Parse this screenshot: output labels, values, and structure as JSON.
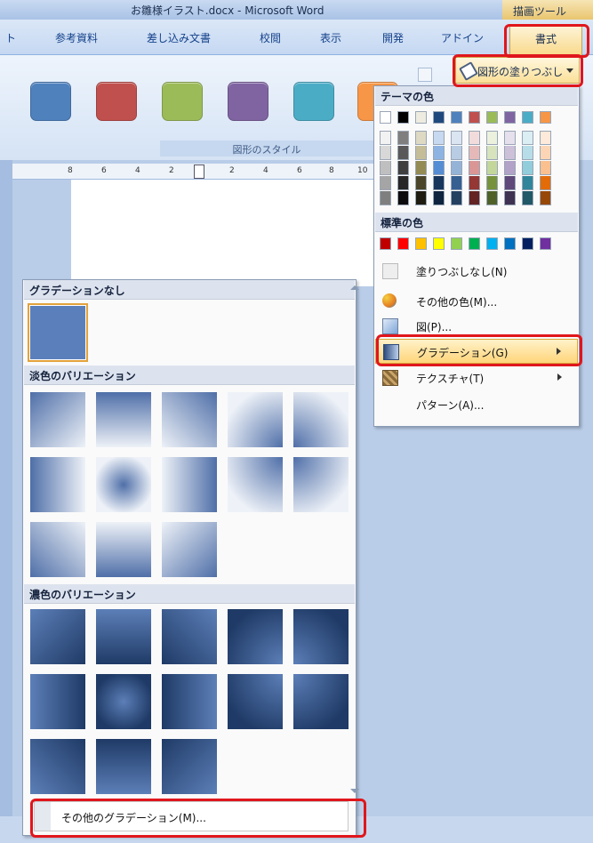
{
  "window": {
    "title": "お雛様イラスト.docx - Microsoft Word",
    "context_tool": "描画ツール"
  },
  "tabs": [
    "ト",
    "参考資料",
    "差し込み文書",
    "校閲",
    "表示",
    "開発",
    "アドイン"
  ],
  "active_tab": "書式",
  "ribbon": {
    "group_label": "図形のスタイル",
    "fill_button": "図形の塗りつぶし",
    "style_colors": [
      "#4f81bd",
      "#c0504d",
      "#9bbb59",
      "#8064a2",
      "#4bacc6",
      "#f79646"
    ]
  },
  "ruler": {
    "ticks": [
      "8",
      "6",
      "4",
      "2",
      "2",
      "4",
      "6",
      "8",
      "10"
    ]
  },
  "gradient_panel": {
    "none_header": "グラデーションなし",
    "light_header": "淡色のバリエーション",
    "dark_header": "濃色のバリエーション",
    "more_gradients": "その他のグラデーション(M)..."
  },
  "color_menu": {
    "theme_header": "テーマの色",
    "standard_header": "標準の色",
    "theme_top_colors": [
      "#ffffff",
      "#000000",
      "#eeece1",
      "#1f497d",
      "#4f81bd",
      "#c0504d",
      "#9bbb59",
      "#8064a2",
      "#4bacc6",
      "#f79646"
    ],
    "standard_colors": [
      "#c00000",
      "#ff0000",
      "#ffc000",
      "#ffff00",
      "#92d050",
      "#00b050",
      "#00b0f0",
      "#0070c0",
      "#002060",
      "#7030a0"
    ],
    "items": {
      "no_fill": "塗りつぶしなし(N)",
      "more_colors": "その他の色(M)...",
      "picture": "図(P)...",
      "gradient": "グラデーション(G)",
      "texture": "テクスチャ(T)",
      "pattern": "パターン(A)..."
    }
  }
}
